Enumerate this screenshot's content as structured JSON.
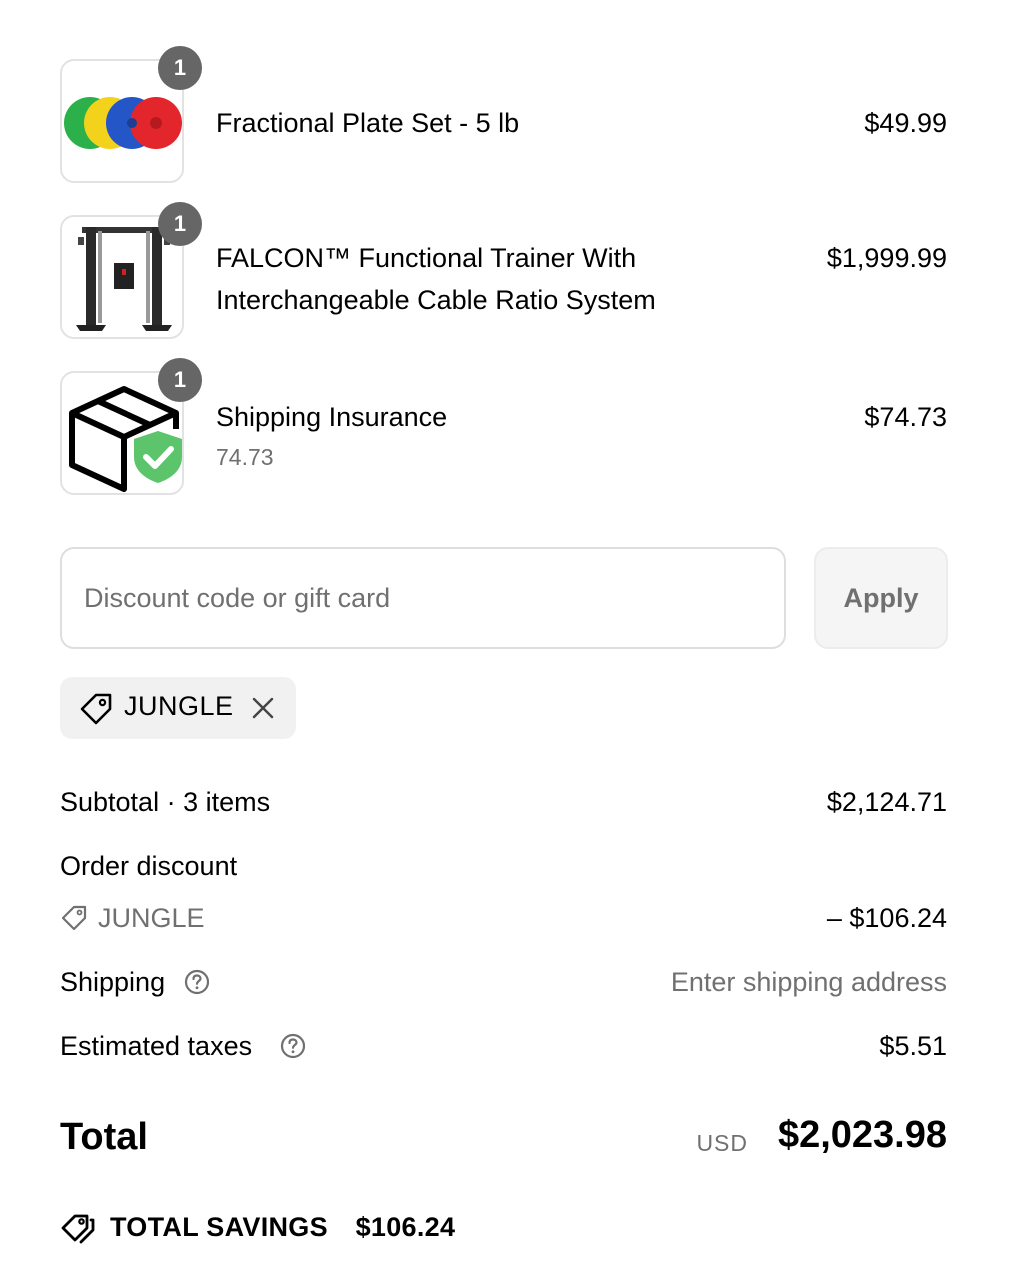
{
  "line_items": [
    {
      "name": "Fractional Plate Set - 5 lb",
      "price": "$49.99",
      "quantity": "1",
      "image_icon": "colored-weight-plates-icon"
    },
    {
      "name_line1": "FALCON™ Functional Trainer With",
      "name_line2": "Interchangeable Cable Ratio System",
      "price": "$1,999.99",
      "quantity": "1",
      "image_icon": "functional-trainer-machine-icon"
    },
    {
      "name": "Shipping Insurance",
      "subtitle": "74.73",
      "price": "$74.73",
      "quantity": "1",
      "image_icon": "package-shield-check-icon"
    }
  ],
  "discount": {
    "placeholder": "Discount code or gift card",
    "apply_label": "Apply",
    "applied_code": "JUNGLE"
  },
  "summary": {
    "subtotal_label": "Subtotal · 3 items",
    "subtotal_value": "$2,124.71",
    "order_discount_label": "Order discount",
    "discount_code": "JUNGLE",
    "discount_value": "– $106.24",
    "shipping_label": "Shipping",
    "shipping_value": "Enter shipping address",
    "taxes_label": "Estimated taxes",
    "taxes_value": "$5.51",
    "total_label": "Total",
    "currency": "USD",
    "total_value": "$2,023.98",
    "savings_label": "TOTAL SAVINGS",
    "savings_value": "$106.24"
  },
  "colors": {
    "badge": "#666666",
    "muted_text": "#707070",
    "chip_bg": "#f1f1f1",
    "shield_green": "#5cc56b"
  }
}
